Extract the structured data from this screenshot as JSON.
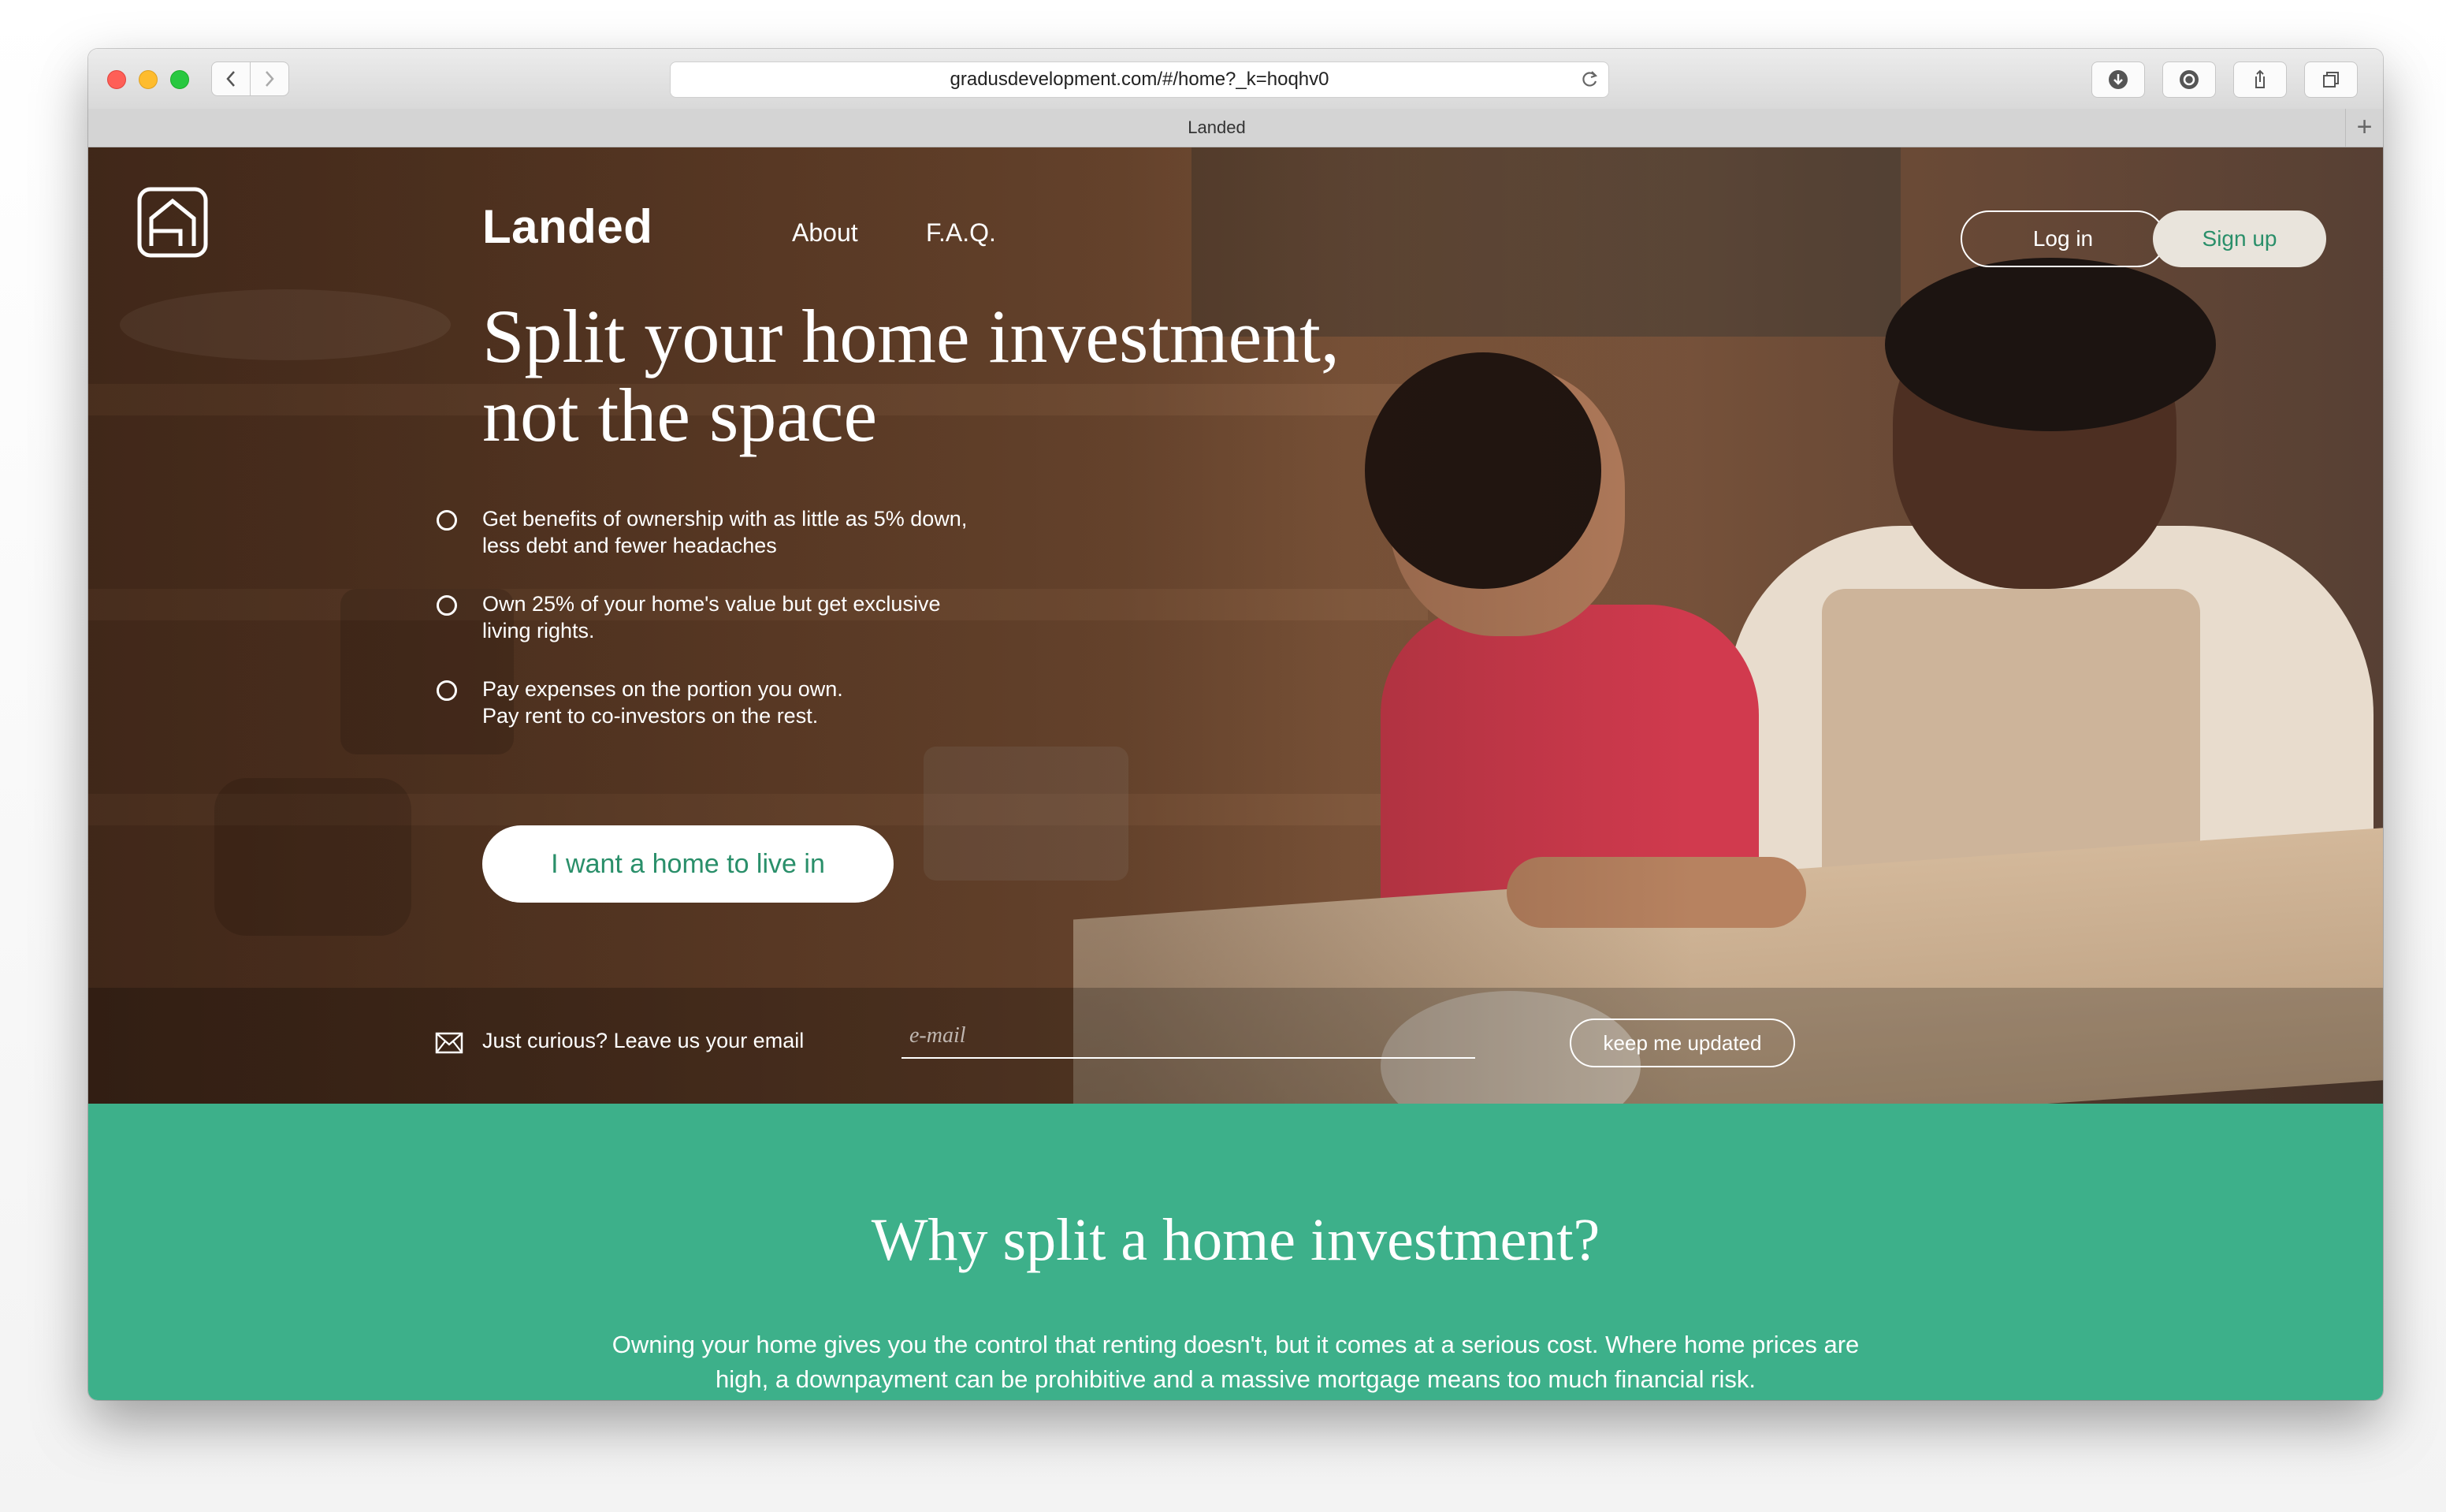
{
  "browser": {
    "url": "gradusdevelopment.com/#/home?_k=hoqhv0",
    "tab_title": "Landed",
    "new_tab_label": "+"
  },
  "header": {
    "brand": "Landed",
    "nav": {
      "about": "About",
      "faq": "F.A.Q."
    },
    "login_label": "Log in",
    "signup_label": "Sign up"
  },
  "hero": {
    "headline_line1": "Split your home investment,",
    "headline_line2": "not the space",
    "features": [
      {
        "line1": "Get benefits of ownership with as little as 5% down,",
        "line2": "less debt and fewer headaches"
      },
      {
        "line1": "Own 25% of your home's value but get exclusive",
        "line2": "living rights."
      },
      {
        "line1": "Pay expenses on the portion you own.",
        "line2": "Pay rent to co-investors on the rest."
      }
    ],
    "cta_label": "I want a home to live in"
  },
  "subscribe": {
    "label": "Just curious? Leave us your email",
    "placeholder": "e-mail",
    "value": "",
    "button_label": "keep me updated"
  },
  "why_section": {
    "title": "Why split a home investment?",
    "body": "Owning your home gives you the control that renting doesn't, but it comes at a serious cost. Where home prices are high, a downpayment can be prohibitive and a massive mortgage means too much financial risk."
  },
  "colors": {
    "accent": "#3db08a",
    "accent_text": "#2a8f6a",
    "signup_bg": "#e9e4dc"
  }
}
